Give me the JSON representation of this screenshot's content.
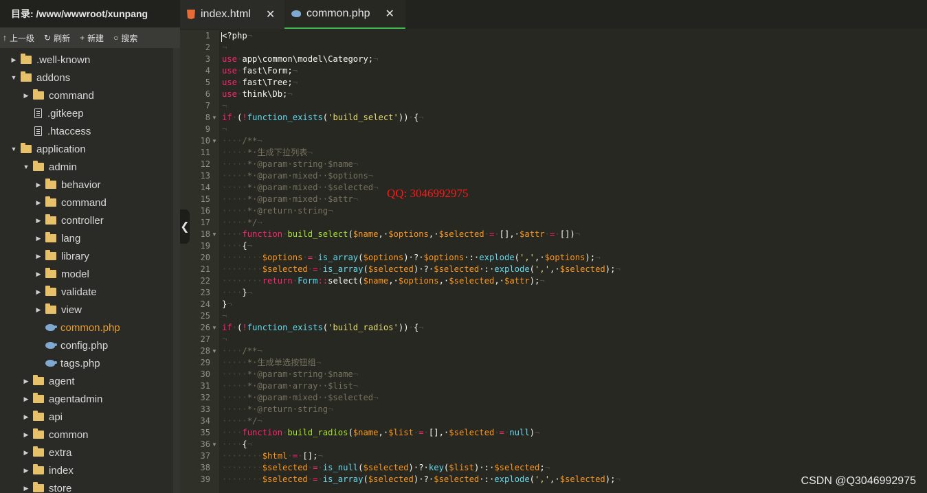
{
  "sidebar": {
    "directory_label": "目录: /www/wwwroot/xunpang",
    "toolbar": [
      {
        "icon": "arrow-up-icon",
        "glyph": "↑",
        "label": "上一级"
      },
      {
        "icon": "refresh-icon",
        "glyph": "↻",
        "label": "刷新"
      },
      {
        "icon": "plus-icon",
        "glyph": "+",
        "label": "新建"
      },
      {
        "icon": "search-icon",
        "glyph": "○",
        "label": "搜索"
      }
    ],
    "tree": [
      {
        "name": ".well-known",
        "type": "folder",
        "depth": 0,
        "expanded": false
      },
      {
        "name": "addons",
        "type": "folder",
        "depth": 0,
        "expanded": true
      },
      {
        "name": "command",
        "type": "folder",
        "depth": 1,
        "expanded": false
      },
      {
        "name": ".gitkeep",
        "type": "file",
        "depth": 1
      },
      {
        "name": ".htaccess",
        "type": "file",
        "depth": 1
      },
      {
        "name": "application",
        "type": "folder",
        "depth": 0,
        "expanded": true
      },
      {
        "name": "admin",
        "type": "folder",
        "depth": 1,
        "expanded": true
      },
      {
        "name": "behavior",
        "type": "folder",
        "depth": 2,
        "expanded": false
      },
      {
        "name": "command",
        "type": "folder",
        "depth": 2,
        "expanded": false
      },
      {
        "name": "controller",
        "type": "folder",
        "depth": 2,
        "expanded": false
      },
      {
        "name": "lang",
        "type": "folder",
        "depth": 2,
        "expanded": false
      },
      {
        "name": "library",
        "type": "folder",
        "depth": 2,
        "expanded": false
      },
      {
        "name": "model",
        "type": "folder",
        "depth": 2,
        "expanded": false
      },
      {
        "name": "validate",
        "type": "folder",
        "depth": 2,
        "expanded": false
      },
      {
        "name": "view",
        "type": "folder",
        "depth": 2,
        "expanded": false
      },
      {
        "name": "common.php",
        "type": "php",
        "depth": 2,
        "active": true
      },
      {
        "name": "config.php",
        "type": "php",
        "depth": 2
      },
      {
        "name": "tags.php",
        "type": "php",
        "depth": 2
      },
      {
        "name": "agent",
        "type": "folder",
        "depth": 1,
        "expanded": false
      },
      {
        "name": "agentadmin",
        "type": "folder",
        "depth": 1,
        "expanded": false
      },
      {
        "name": "api",
        "type": "folder",
        "depth": 1,
        "expanded": false
      },
      {
        "name": "common",
        "type": "folder",
        "depth": 1,
        "expanded": false
      },
      {
        "name": "extra",
        "type": "folder",
        "depth": 1,
        "expanded": false
      },
      {
        "name": "index",
        "type": "folder",
        "depth": 1,
        "expanded": false
      },
      {
        "name": "store",
        "type": "folder",
        "depth": 1,
        "expanded": false
      }
    ]
  },
  "tabs": [
    {
      "label": "index.html",
      "icon": "html5-icon",
      "close": "✕"
    },
    {
      "label": "common.php",
      "icon": "php-icon",
      "close": "✕",
      "active": true
    }
  ],
  "editor": {
    "folds": [
      8,
      10,
      18,
      26,
      28,
      36
    ],
    "lines": [
      [
        [
          "<?php",
          "t"
        ],
        [
          "¬",
          "inv"
        ]
      ],
      [
        [
          "¬",
          "inv"
        ]
      ],
      [
        [
          "use",
          "kw"
        ],
        [
          "·",
          "inv"
        ],
        [
          "app\\common\\model\\Category;",
          "t"
        ],
        [
          "¬",
          "inv"
        ]
      ],
      [
        [
          "use",
          "kw"
        ],
        [
          "·",
          "inv"
        ],
        [
          "fast\\Form;",
          "t"
        ],
        [
          "¬",
          "inv"
        ]
      ],
      [
        [
          "use",
          "kw"
        ],
        [
          "·",
          "inv"
        ],
        [
          "fast\\Tree;",
          "t"
        ],
        [
          "¬",
          "inv"
        ]
      ],
      [
        [
          "use",
          "kw"
        ],
        [
          "·",
          "inv"
        ],
        [
          "think\\Db;",
          "t"
        ],
        [
          "¬",
          "inv"
        ]
      ],
      [
        [
          "¬",
          "inv"
        ]
      ],
      [
        [
          "if",
          "kw"
        ],
        [
          "·",
          "inv"
        ],
        [
          "(",
          "t"
        ],
        [
          "!",
          "kw"
        ],
        [
          "function_exists",
          "fn"
        ],
        [
          "(",
          "t"
        ],
        [
          "'build_select'",
          "str"
        ],
        [
          "))",
          "t"
        ],
        [
          "·",
          "inv"
        ],
        [
          "{",
          "t"
        ],
        [
          "¬",
          "inv"
        ]
      ],
      [
        [
          "¬",
          "inv"
        ]
      ],
      [
        [
          "····",
          "inv"
        ],
        [
          "/**",
          "cm"
        ],
        [
          "¬",
          "inv"
        ]
      ],
      [
        [
          "·····",
          "inv"
        ],
        [
          "*·生成下拉列表",
          "cm"
        ],
        [
          "¬",
          "inv"
        ]
      ],
      [
        [
          "·····",
          "inv"
        ],
        [
          "*·@param·string·$name",
          "cm"
        ],
        [
          "¬",
          "inv"
        ]
      ],
      [
        [
          "·····",
          "inv"
        ],
        [
          "*·@param·mixed··$options",
          "cm"
        ],
        [
          "¬",
          "inv"
        ]
      ],
      [
        [
          "·····",
          "inv"
        ],
        [
          "*·@param·mixed··$selected",
          "cm"
        ],
        [
          "¬",
          "inv"
        ]
      ],
      [
        [
          "·····",
          "inv"
        ],
        [
          "*·@param·mixed··$attr",
          "cm"
        ],
        [
          "¬",
          "inv"
        ]
      ],
      [
        [
          "·····",
          "inv"
        ],
        [
          "*·@return·string",
          "cm"
        ],
        [
          "¬",
          "inv"
        ]
      ],
      [
        [
          "·····",
          "inv"
        ],
        [
          "*/",
          "cm"
        ],
        [
          "¬",
          "inv"
        ]
      ],
      [
        [
          "····",
          "inv"
        ],
        [
          "function",
          "kw"
        ],
        [
          "·",
          "inv"
        ],
        [
          "build_select",
          "cls"
        ],
        [
          "(",
          "t"
        ],
        [
          "$name",
          "var"
        ],
        [
          ",·",
          "t"
        ],
        [
          "$options",
          "var"
        ],
        [
          ",·",
          "t"
        ],
        [
          "$selected",
          "var"
        ],
        [
          "·",
          "inv"
        ],
        [
          "=",
          "kw"
        ],
        [
          "·",
          "inv"
        ],
        [
          "[],·",
          "t"
        ],
        [
          "$attr",
          "var"
        ],
        [
          "·",
          "inv"
        ],
        [
          "=",
          "kw"
        ],
        [
          "·",
          "inv"
        ],
        [
          "[])",
          "t"
        ],
        [
          "¬",
          "inv"
        ]
      ],
      [
        [
          "····",
          "inv"
        ],
        [
          "{",
          "t"
        ],
        [
          "¬",
          "inv"
        ]
      ],
      [
        [
          "········",
          "inv"
        ],
        [
          "$options",
          "var"
        ],
        [
          "·",
          "inv"
        ],
        [
          "=",
          "kw"
        ],
        [
          "·",
          "inv"
        ],
        [
          "is_array",
          "fn"
        ],
        [
          "(",
          "t"
        ],
        [
          "$options",
          "var"
        ],
        [
          ")·?·",
          "t"
        ],
        [
          "$options",
          "var"
        ],
        [
          "·:·",
          "t"
        ],
        [
          "explode",
          "fn"
        ],
        [
          "(",
          "t"
        ],
        [
          "','",
          "str"
        ],
        [
          ",·",
          "t"
        ],
        [
          "$options",
          "var"
        ],
        [
          ");",
          "t"
        ],
        [
          "¬",
          "inv"
        ]
      ],
      [
        [
          "········",
          "inv"
        ],
        [
          "$selected",
          "var"
        ],
        [
          "·",
          "inv"
        ],
        [
          "=",
          "kw"
        ],
        [
          "·",
          "inv"
        ],
        [
          "is_array",
          "fn"
        ],
        [
          "(",
          "t"
        ],
        [
          "$selected",
          "var"
        ],
        [
          ")·?·",
          "t"
        ],
        [
          "$selected",
          "var"
        ],
        [
          "·:·",
          "t"
        ],
        [
          "explode",
          "fn"
        ],
        [
          "(",
          "t"
        ],
        [
          "','",
          "str"
        ],
        [
          ",·",
          "t"
        ],
        [
          "$selected",
          "var"
        ],
        [
          ");",
          "t"
        ],
        [
          "¬",
          "inv"
        ]
      ],
      [
        [
          "········",
          "inv"
        ],
        [
          "return",
          "kw"
        ],
        [
          "·",
          "inv"
        ],
        [
          "Form",
          "fn"
        ],
        [
          "::",
          "kw"
        ],
        [
          "select(",
          "t"
        ],
        [
          "$name",
          "var"
        ],
        [
          ",·",
          "t"
        ],
        [
          "$options",
          "var"
        ],
        [
          ",·",
          "t"
        ],
        [
          "$selected",
          "var"
        ],
        [
          ",·",
          "t"
        ],
        [
          "$attr",
          "var"
        ],
        [
          ");",
          "t"
        ],
        [
          "¬",
          "inv"
        ]
      ],
      [
        [
          "····",
          "inv"
        ],
        [
          "}",
          "t"
        ],
        [
          "¬",
          "inv"
        ]
      ],
      [
        [
          "}",
          "t"
        ],
        [
          "¬",
          "inv"
        ]
      ],
      [
        [
          "¬",
          "inv"
        ]
      ],
      [
        [
          "if",
          "kw"
        ],
        [
          "·",
          "inv"
        ],
        [
          "(",
          "t"
        ],
        [
          "!",
          "kw"
        ],
        [
          "function_exists",
          "fn"
        ],
        [
          "(",
          "t"
        ],
        [
          "'build_radios'",
          "str"
        ],
        [
          "))",
          "t"
        ],
        [
          "·",
          "inv"
        ],
        [
          "{",
          "t"
        ],
        [
          "¬",
          "inv"
        ]
      ],
      [
        [
          "¬",
          "inv"
        ]
      ],
      [
        [
          "····",
          "inv"
        ],
        [
          "/**",
          "cm"
        ],
        [
          "¬",
          "inv"
        ]
      ],
      [
        [
          "·····",
          "inv"
        ],
        [
          "*·生成单选按钮组",
          "cm"
        ],
        [
          "¬",
          "inv"
        ]
      ],
      [
        [
          "·····",
          "inv"
        ],
        [
          "*·@param·string·$name",
          "cm"
        ],
        [
          "¬",
          "inv"
        ]
      ],
      [
        [
          "·····",
          "inv"
        ],
        [
          "*·@param·array··$list",
          "cm"
        ],
        [
          "¬",
          "inv"
        ]
      ],
      [
        [
          "·····",
          "inv"
        ],
        [
          "*·@param·mixed··$selected",
          "cm"
        ],
        [
          "¬",
          "inv"
        ]
      ],
      [
        [
          "·····",
          "inv"
        ],
        [
          "*·@return·string",
          "cm"
        ],
        [
          "¬",
          "inv"
        ]
      ],
      [
        [
          "·····",
          "inv"
        ],
        [
          "*/",
          "cm"
        ],
        [
          "¬",
          "inv"
        ]
      ],
      [
        [
          "····",
          "inv"
        ],
        [
          "function",
          "kw"
        ],
        [
          "·",
          "inv"
        ],
        [
          "build_radios",
          "cls"
        ],
        [
          "(",
          "t"
        ],
        [
          "$name",
          "var"
        ],
        [
          ",·",
          "t"
        ],
        [
          "$list",
          "var"
        ],
        [
          "·",
          "inv"
        ],
        [
          "=",
          "kw"
        ],
        [
          "·",
          "inv"
        ],
        [
          "[],·",
          "t"
        ],
        [
          "$selected",
          "var"
        ],
        [
          "·",
          "inv"
        ],
        [
          "=",
          "kw"
        ],
        [
          "·",
          "inv"
        ],
        [
          "null",
          "fn"
        ],
        [
          ")",
          "t"
        ],
        [
          "¬",
          "inv"
        ]
      ],
      [
        [
          "····",
          "inv"
        ],
        [
          "{",
          "t"
        ],
        [
          "¬",
          "inv"
        ]
      ],
      [
        [
          "········",
          "inv"
        ],
        [
          "$html",
          "var"
        ],
        [
          "·",
          "inv"
        ],
        [
          "=",
          "kw"
        ],
        [
          "·",
          "inv"
        ],
        [
          "[];",
          "t"
        ],
        [
          "¬",
          "inv"
        ]
      ],
      [
        [
          "········",
          "inv"
        ],
        [
          "$selected",
          "var"
        ],
        [
          "·",
          "inv"
        ],
        [
          "=",
          "kw"
        ],
        [
          "·",
          "inv"
        ],
        [
          "is_null",
          "fn"
        ],
        [
          "(",
          "t"
        ],
        [
          "$selected",
          "var"
        ],
        [
          ")·?·",
          "t"
        ],
        [
          "key",
          "fn"
        ],
        [
          "(",
          "t"
        ],
        [
          "$list",
          "var"
        ],
        [
          ")·:·",
          "t"
        ],
        [
          "$selected",
          "var"
        ],
        [
          ";",
          "t"
        ],
        [
          "¬",
          "inv"
        ]
      ],
      [
        [
          "········",
          "inv"
        ],
        [
          "$selected",
          "var"
        ],
        [
          "·",
          "inv"
        ],
        [
          "=",
          "kw"
        ],
        [
          "·",
          "inv"
        ],
        [
          "is_array",
          "fn"
        ],
        [
          "(",
          "t"
        ],
        [
          "$selected",
          "var"
        ],
        [
          ")·?·",
          "t"
        ],
        [
          "$selected",
          "var"
        ],
        [
          "·:·",
          "t"
        ],
        [
          "explode",
          "fn"
        ],
        [
          "(",
          "t"
        ],
        [
          "','",
          "str"
        ],
        [
          ",·",
          "t"
        ],
        [
          "$selected",
          "var"
        ],
        [
          ");",
          "t"
        ],
        [
          "¬",
          "inv"
        ]
      ]
    ]
  },
  "watermarks": {
    "qq": "QQ: 3046992975",
    "csdn": "CSDN @Q3046992975"
  }
}
